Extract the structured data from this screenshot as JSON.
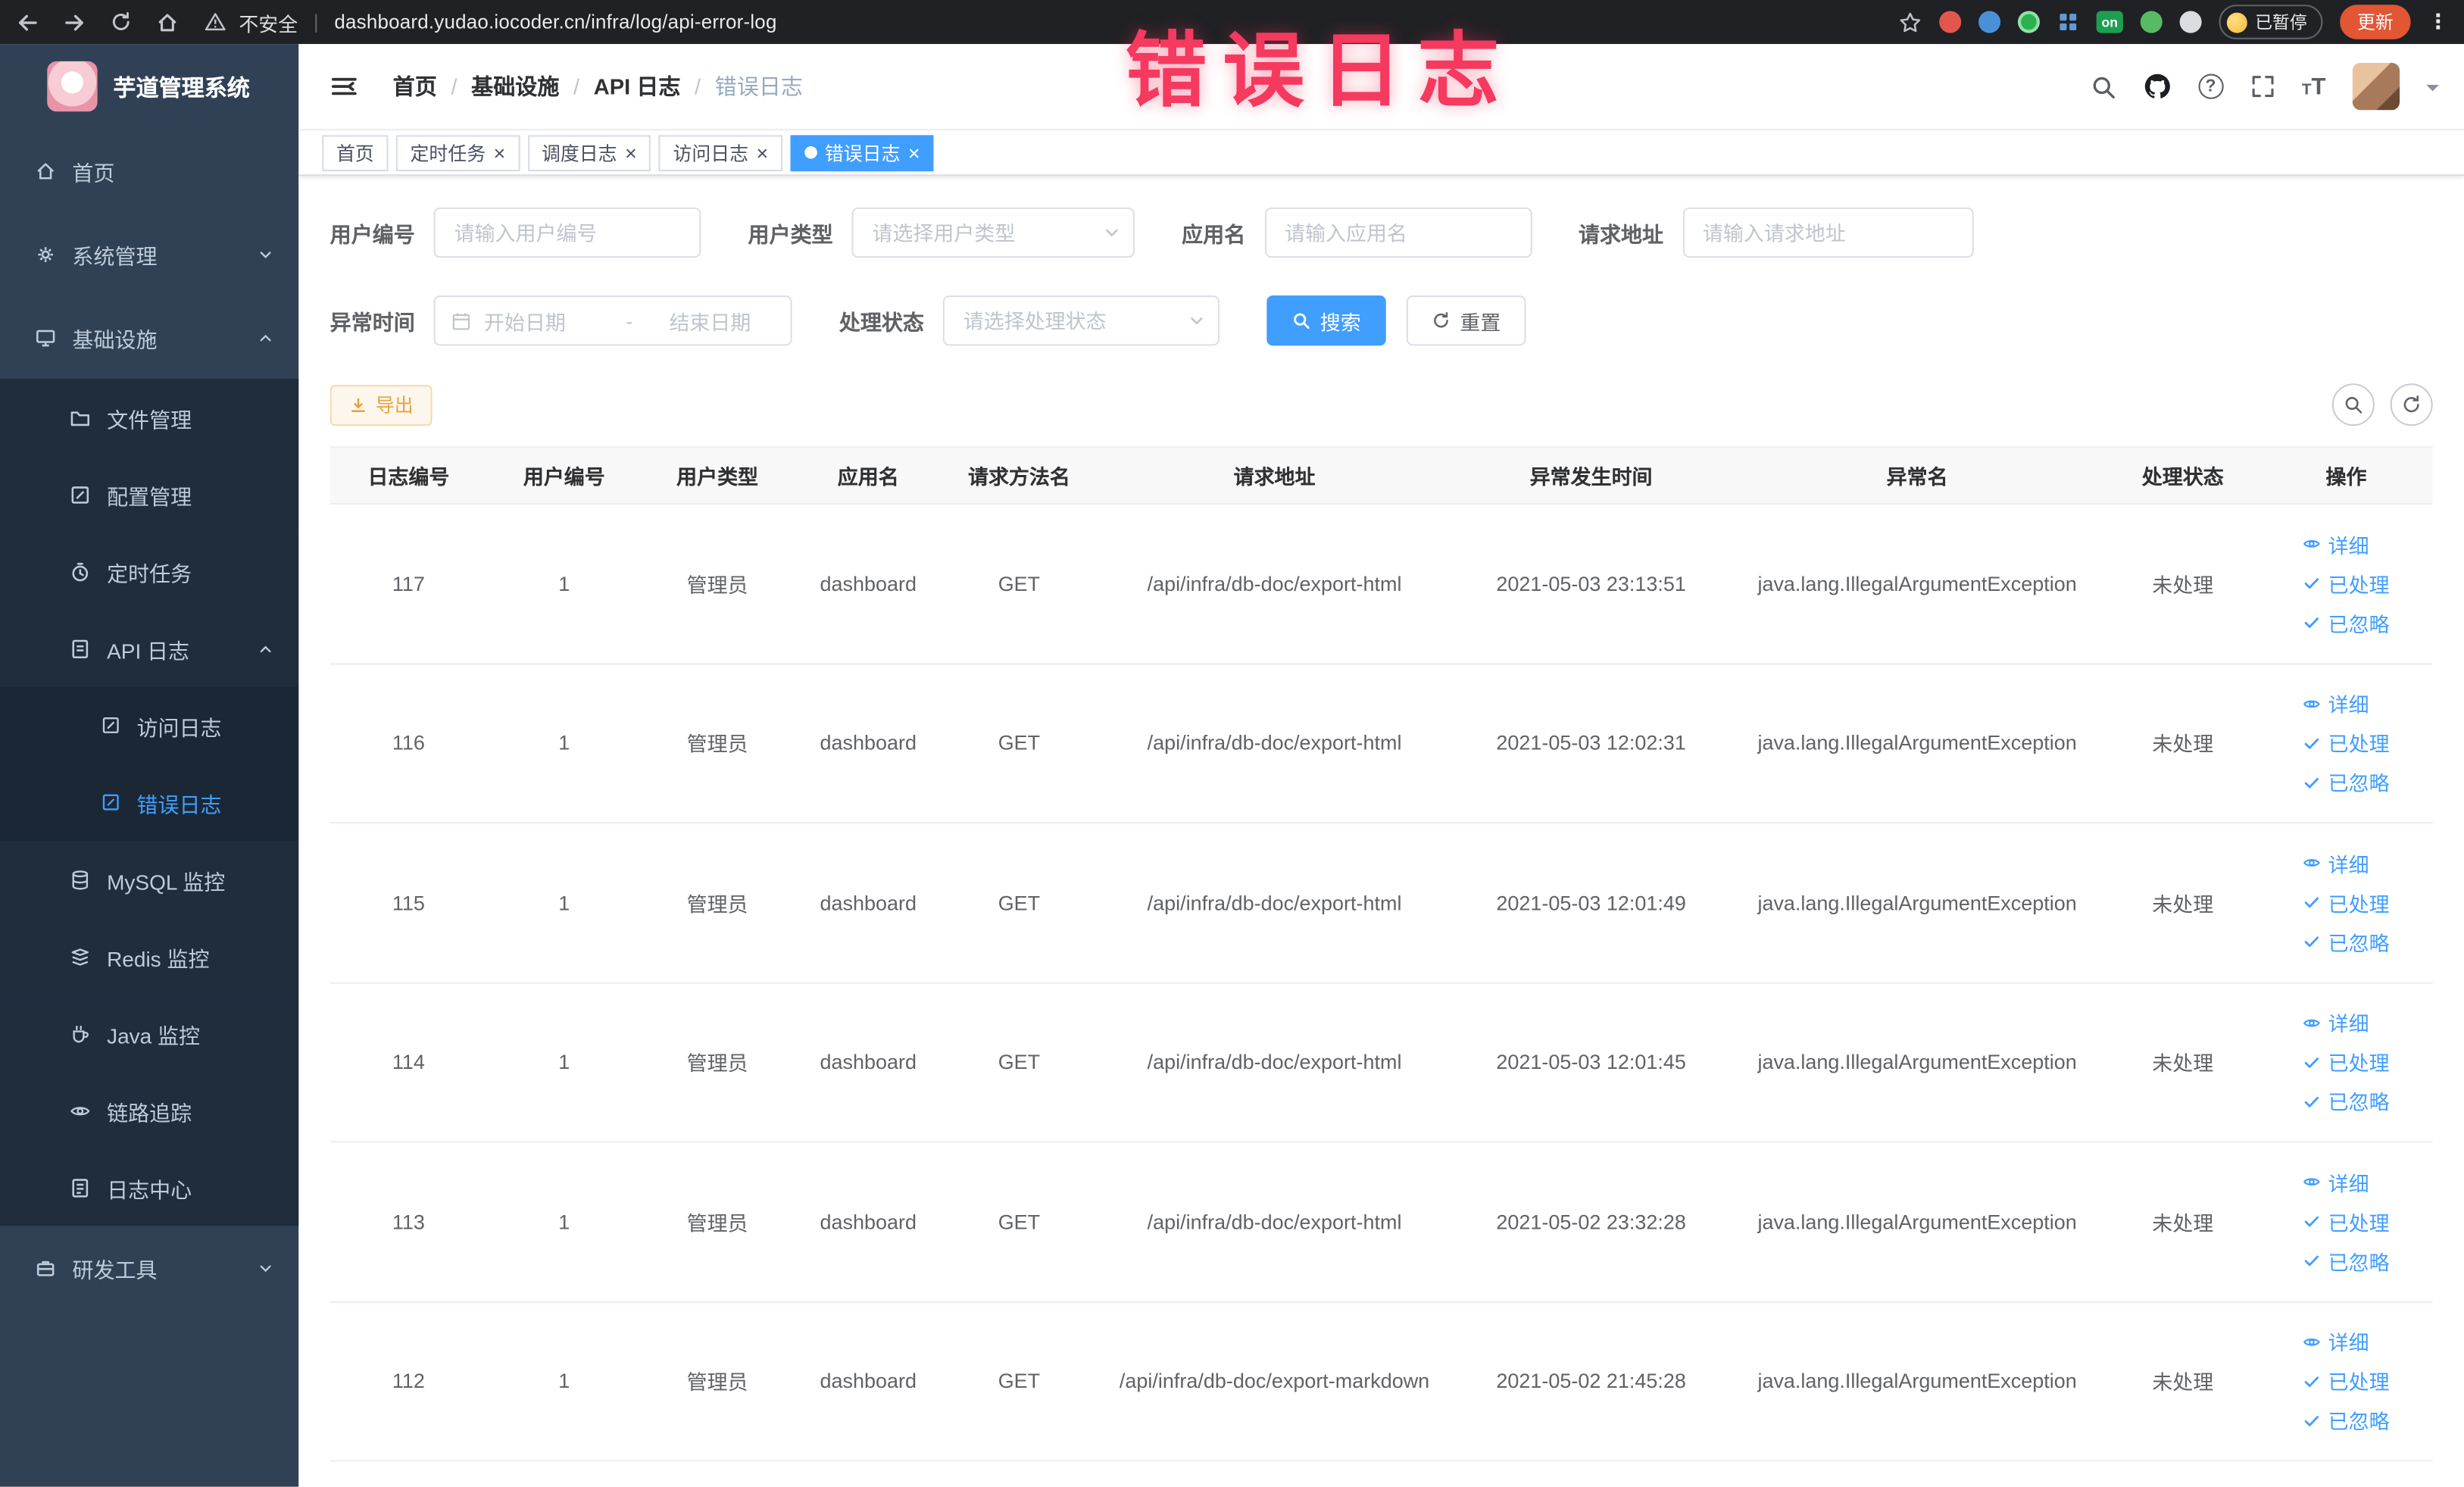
{
  "browser": {
    "security_label": "不安全",
    "url": "dashboard.yudao.iocoder.cn/infra/log/api-error-log",
    "ext_on_badge": "on",
    "paused_label": "已暂停",
    "update_label": "更新"
  },
  "annotation": {
    "text": "错误日志",
    "color": "#f5395f"
  },
  "sidebar": {
    "title": "芋道管理系统",
    "items": [
      {
        "label": "首页"
      },
      {
        "label": "系统管理"
      },
      {
        "label": "基础设施"
      },
      {
        "label": "文件管理"
      },
      {
        "label": "配置管理"
      },
      {
        "label": "定时任务"
      },
      {
        "label": "API 日志"
      },
      {
        "label": "访问日志"
      },
      {
        "label": "错误日志"
      },
      {
        "label": "MySQL 监控"
      },
      {
        "label": "Redis 监控"
      },
      {
        "label": "Java 监控"
      },
      {
        "label": "链路追踪"
      },
      {
        "label": "日志中心"
      },
      {
        "label": "研发工具"
      }
    ]
  },
  "header": {
    "breadcrumb": [
      "首页",
      "基础设施",
      "API 日志",
      "错误日志"
    ]
  },
  "tabs": [
    {
      "label": "首页"
    },
    {
      "label": "定时任务",
      "closable": true
    },
    {
      "label": "调度日志",
      "closable": true
    },
    {
      "label": "访问日志",
      "closable": true
    },
    {
      "label": "错误日志",
      "closable": true,
      "active": true
    }
  ],
  "filters": {
    "user_id": {
      "label": "用户编号",
      "placeholder": "请输入用户编号"
    },
    "user_type": {
      "label": "用户类型",
      "placeholder": "请选择用户类型"
    },
    "app_name": {
      "label": "应用名",
      "placeholder": "请输入应用名"
    },
    "request_url": {
      "label": "请求地址",
      "placeholder": "请输入请求地址"
    },
    "exception_time": {
      "label": "异常时间",
      "start_placeholder": "开始日期",
      "separator": "-",
      "end_placeholder": "结束日期"
    },
    "process_status": {
      "label": "处理状态",
      "placeholder": "请选择处理状态"
    },
    "search_label": "搜索",
    "reset_label": "重置"
  },
  "toolbar": {
    "export_label": "导出"
  },
  "table": {
    "columns": [
      "日志编号",
      "用户编号",
      "用户类型",
      "应用名",
      "请求方法名",
      "请求地址",
      "异常发生时间",
      "异常名",
      "处理状态",
      "操作"
    ],
    "action_labels": {
      "detail": "详细",
      "processed": "已处理",
      "ignored": "已忽略"
    },
    "rows": [
      {
        "id": "117",
        "user_id": "1",
        "user_type": "管理员",
        "app": "dashboard",
        "method": "GET",
        "url": "/api/infra/db-doc/export-html",
        "time": "2021-05-03 23:13:51",
        "exception": "java.lang.IllegalArgumentException",
        "status": "未处理"
      },
      {
        "id": "116",
        "user_id": "1",
        "user_type": "管理员",
        "app": "dashboard",
        "method": "GET",
        "url": "/api/infra/db-doc/export-html",
        "time": "2021-05-03 12:02:31",
        "exception": "java.lang.IllegalArgumentException",
        "status": "未处理"
      },
      {
        "id": "115",
        "user_id": "1",
        "user_type": "管理员",
        "app": "dashboard",
        "method": "GET",
        "url": "/api/infra/db-doc/export-html",
        "time": "2021-05-03 12:01:49",
        "exception": "java.lang.IllegalArgumentException",
        "status": "未处理"
      },
      {
        "id": "114",
        "user_id": "1",
        "user_type": "管理员",
        "app": "dashboard",
        "method": "GET",
        "url": "/api/infra/db-doc/export-html",
        "time": "2021-05-03 12:01:45",
        "exception": "java.lang.IllegalArgumentException",
        "status": "未处理"
      },
      {
        "id": "113",
        "user_id": "1",
        "user_type": "管理员",
        "app": "dashboard",
        "method": "GET",
        "url": "/api/infra/db-doc/export-html",
        "time": "2021-05-02 23:32:28",
        "exception": "java.lang.IllegalArgumentException",
        "status": "未处理"
      },
      {
        "id": "112",
        "user_id": "1",
        "user_type": "管理员",
        "app": "dashboard",
        "method": "GET",
        "url": "/api/infra/db-doc/export-markdown",
        "time": "2021-05-02 21:45:28",
        "exception": "java.lang.IllegalArgumentException",
        "status": "未处理"
      }
    ]
  },
  "colors": {
    "accent": "#409eff",
    "sidebar_bg": "#304156",
    "submenu_bg": "#1f2d3d",
    "warning": "#e6a23c",
    "active_tab_bg": "#409eff"
  }
}
